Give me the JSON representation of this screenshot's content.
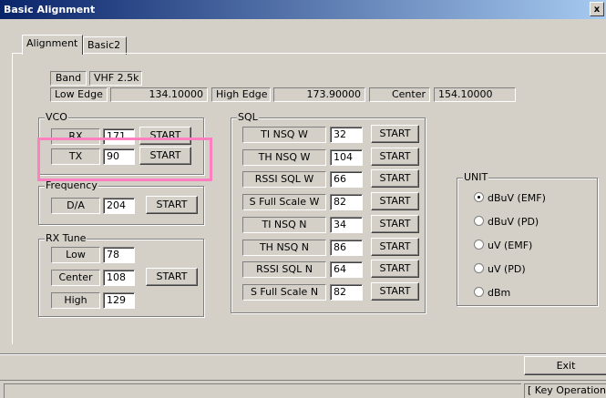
{
  "window": {
    "title": "Basic Alignment",
    "close_glyph": "x"
  },
  "tabs": [
    {
      "label": "Alignment"
    },
    {
      "label": "Basic2"
    }
  ],
  "info": {
    "band_label": "Band",
    "band_value": "VHF 2.5k",
    "low_edge_label": "Low Edge",
    "low_edge_value": "134.10000",
    "high_edge_label": "High Edge",
    "high_edge_value": "173.90000",
    "center_label": "Center",
    "center_value": "154.10000"
  },
  "vco": {
    "title": "VCO",
    "rx": {
      "label": "RX",
      "value": "171",
      "button": "START"
    },
    "tx": {
      "label": "TX",
      "value": "90",
      "button": "START"
    }
  },
  "frequency": {
    "title": "Frequency",
    "da": {
      "label": "D/A",
      "value": "204",
      "button": "START"
    }
  },
  "rx_tune": {
    "title": "RX Tune",
    "low": {
      "label": "Low",
      "value": "78"
    },
    "center": {
      "label": "Center",
      "value": "108"
    },
    "high": {
      "label": "High",
      "value": "129"
    },
    "button": "START"
  },
  "sql": {
    "title": "SQL",
    "rows": [
      {
        "label": "TI NSQ W",
        "value": "32",
        "button": "START"
      },
      {
        "label": "TH NSQ W",
        "value": "104",
        "button": "START"
      },
      {
        "label": "RSSI SQL W",
        "value": "66",
        "button": "START"
      },
      {
        "label": "S Full Scale W",
        "value": "82",
        "button": "START"
      },
      {
        "label": "TI NSQ N",
        "value": "34",
        "button": "START"
      },
      {
        "label": "TH NSQ N",
        "value": "86",
        "button": "START"
      },
      {
        "label": "RSSI SQL N",
        "value": "64",
        "button": "START"
      },
      {
        "label": "S Full Scale N",
        "value": "82",
        "button": "START"
      }
    ]
  },
  "unit": {
    "title": "UNIT",
    "selected": "dBuV (EMF)",
    "options": [
      {
        "label": "dBuV (EMF)"
      },
      {
        "label": "dBuV (PD)"
      },
      {
        "label": "uV (EMF)"
      },
      {
        "label": "uV (PD)"
      },
      {
        "label": "dBm"
      }
    ]
  },
  "exit_label": "Exit",
  "status": {
    "key_operation": "[ Key Operation"
  },
  "colors": {
    "face": "#d4d0c8",
    "highlight_box": "#ff7fc0",
    "title_start": "#0a246a",
    "title_end": "#a6caf0"
  }
}
